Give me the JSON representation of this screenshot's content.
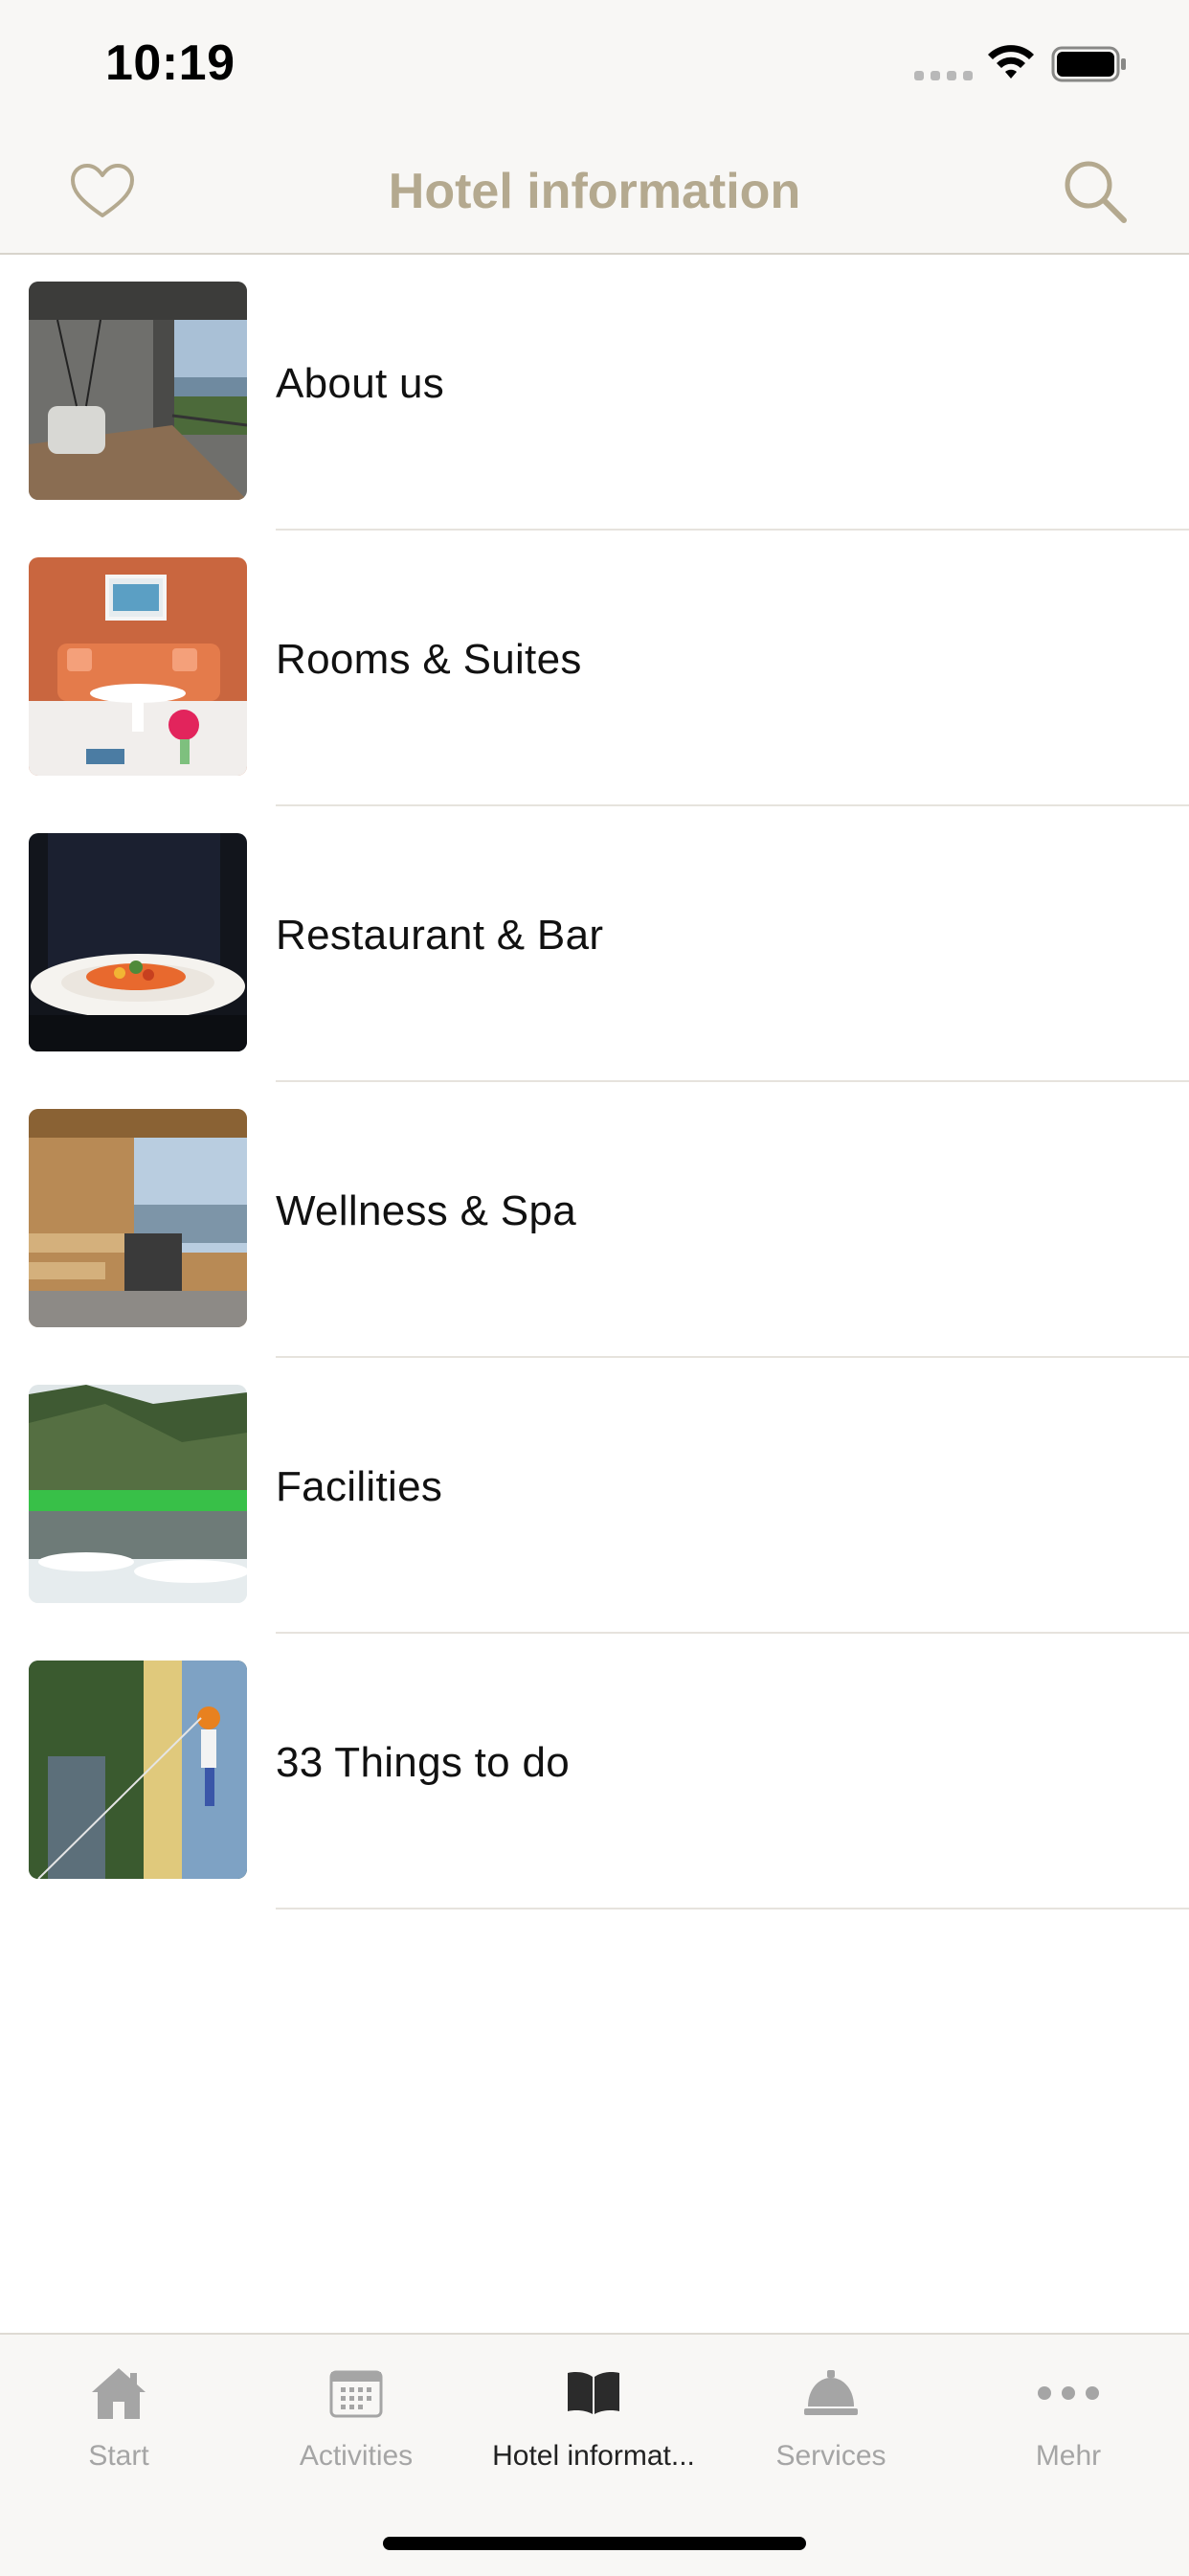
{
  "status_bar": {
    "time": "10:19",
    "icons": [
      "signal-icon",
      "wifi-icon",
      "battery-icon"
    ]
  },
  "header": {
    "title": "Hotel information",
    "left_icon": "heart-icon",
    "right_icon": "search-icon",
    "title_color": "#b4a98f"
  },
  "items": [
    {
      "label": "About us",
      "image": "hotel balcony with hanging chair and lake view"
    },
    {
      "label": "Rooms & Suites",
      "image": "orange living room with sofa and pink flowers"
    },
    {
      "label": "Restaurant & Bar",
      "image": "plated pasta dish held by waiter"
    },
    {
      "label": "Wellness & Spa",
      "image": "sauna room with lake view"
    },
    {
      "label": "Facilities",
      "image": "lake with green mountains"
    },
    {
      "label": "33 Things to do",
      "image": "person climbing wall"
    }
  ],
  "tabs": [
    {
      "label": "Start",
      "icon": "home-icon",
      "active": false
    },
    {
      "label": "Activities",
      "icon": "calendar-icon",
      "active": false
    },
    {
      "label": "Hotel informat...",
      "icon": "book-icon",
      "active": true
    },
    {
      "label": "Services",
      "icon": "service-bell-icon",
      "active": false
    },
    {
      "label": "Mehr",
      "icon": "more-icon",
      "active": false
    }
  ],
  "colors": {
    "accent": "#b4a98f",
    "bar_background": "#f8f7f5",
    "inactive_tab": "#a5a5a5",
    "active_tab": "#222222"
  }
}
